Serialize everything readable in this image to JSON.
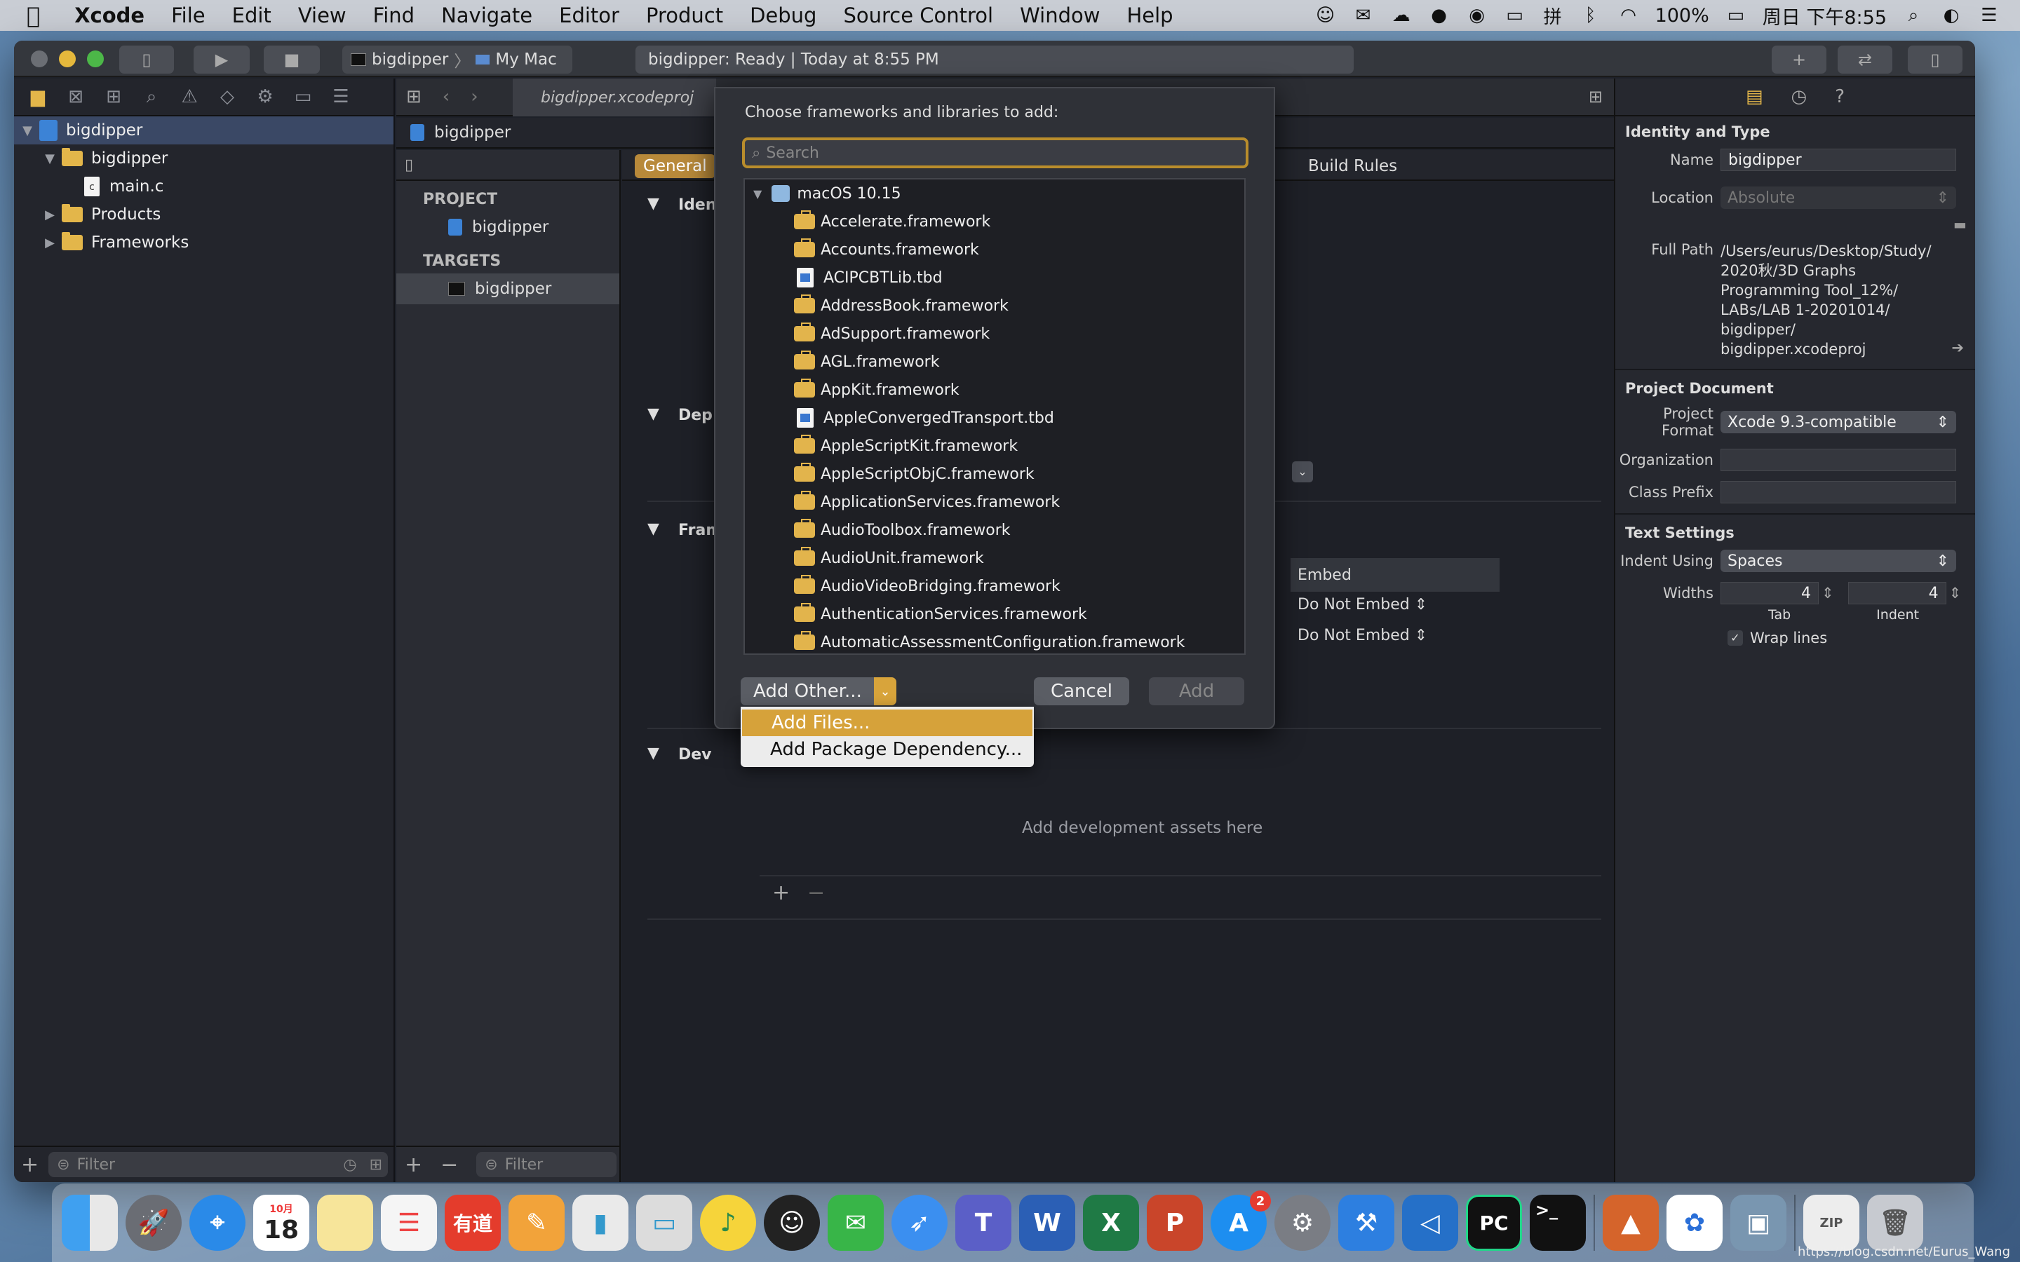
{
  "menubar": {
    "app": "Xcode",
    "items": [
      "File",
      "Edit",
      "View",
      "Find",
      "Navigate",
      "Editor",
      "Product",
      "Debug",
      "Source Control",
      "Window",
      "Help"
    ],
    "battery": "100%",
    "clock": "周日 下午8:55"
  },
  "toolbar": {
    "scheme": "bigdipper",
    "destination": "My Mac",
    "activity": "bigdipper: Ready | Today at 8:55 PM"
  },
  "navigator": {
    "tree": [
      {
        "label": "bigdipper",
        "kind": "project",
        "level": 0
      },
      {
        "label": "bigdipper",
        "kind": "folder",
        "level": 1
      },
      {
        "label": "main.c",
        "kind": "file",
        "level": 2
      },
      {
        "label": "Products",
        "kind": "folder",
        "level": 1
      },
      {
        "label": "Frameworks",
        "kind": "folder",
        "level": 1
      }
    ],
    "filter_placeholder": "Filter"
  },
  "editor": {
    "tab_file": "bigdipper.xcodeproj",
    "jump_item": "bigdipper",
    "project_header": "PROJECT",
    "project_item": "bigdipper",
    "targets_header": "TARGETS",
    "target_item": "bigdipper",
    "target_filter_placeholder": "Filter",
    "tab_general": "General",
    "tab_build_rules": "Build Rules",
    "section_identity": "Iden",
    "section_deployment": "Dep",
    "section_frameworks": "Fram",
    "section_development": "Dev",
    "embed_header": "Embed",
    "embed_rows": [
      "Do Not Embed",
      "Do Not Embed"
    ],
    "dev_assets_hint": "Add development assets here"
  },
  "sheet": {
    "title": "Choose frameworks and libraries to add:",
    "search_placeholder": "Search",
    "sdk_group": "macOS 10.15",
    "items": [
      {
        "name": "Accelerate.framework",
        "kind": "framework"
      },
      {
        "name": "Accounts.framework",
        "kind": "framework"
      },
      {
        "name": "ACIPCBTLib.tbd",
        "kind": "tbd"
      },
      {
        "name": "AddressBook.framework",
        "kind": "framework"
      },
      {
        "name": "AdSupport.framework",
        "kind": "framework"
      },
      {
        "name": "AGL.framework",
        "kind": "framework"
      },
      {
        "name": "AppKit.framework",
        "kind": "framework"
      },
      {
        "name": "AppleConvergedTransport.tbd",
        "kind": "tbd"
      },
      {
        "name": "AppleScriptKit.framework",
        "kind": "framework"
      },
      {
        "name": "AppleScriptObjC.framework",
        "kind": "framework"
      },
      {
        "name": "ApplicationServices.framework",
        "kind": "framework"
      },
      {
        "name": "AudioToolbox.framework",
        "kind": "framework"
      },
      {
        "name": "AudioUnit.framework",
        "kind": "framework"
      },
      {
        "name": "AudioVideoBridging.framework",
        "kind": "framework"
      },
      {
        "name": "AuthenticationServices.framework",
        "kind": "framework"
      },
      {
        "name": "AutomaticAssessmentConfiguration.framework",
        "kind": "framework"
      }
    ],
    "add_other_label": "Add Other...",
    "cancel_label": "Cancel",
    "add_label": "Add",
    "dropdown": [
      "Add Files...",
      "Add Package Dependency..."
    ]
  },
  "inspector": {
    "identity_header": "Identity and Type",
    "name_label": "Name",
    "name_value": "bigdipper",
    "location_label": "Location",
    "location_value": "Absolute",
    "fullpath_label": "Full Path",
    "fullpath_lines": [
      "/Users/eurus/Desktop/Study/",
      "2020秋/3D Graphs",
      "Programming Tool_12%/",
      "LABs/LAB 1-20201014/",
      "bigdipper/",
      "bigdipper.xcodeproj"
    ],
    "projdoc_header": "Project Document",
    "format_label": "Project Format",
    "format_value": "Xcode 9.3-compatible",
    "org_label": "Organization",
    "prefix_label": "Class Prefix",
    "text_header": "Text Settings",
    "indent_label": "Indent Using",
    "indent_value": "Spaces",
    "widths_label": "Widths",
    "tab_width": "4",
    "indent_width": "4",
    "tab_caption": "Tab",
    "indent_caption": "Indent",
    "wrap_label": "Wrap lines"
  },
  "dock": {
    "calendar_month": "10月",
    "calendar_day": "18",
    "appstore_badge": "2",
    "youdao": "有道",
    "word": "W",
    "excel": "X",
    "ppt": "P",
    "pycharm": "PC",
    "terminal": ">_"
  },
  "watermark": "https://blog.csdn.net/Eurus_Wang"
}
